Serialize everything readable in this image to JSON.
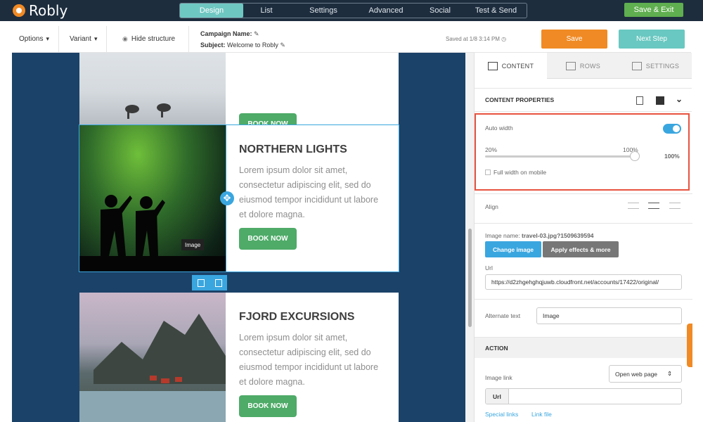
{
  "brand": {
    "name": "Robly"
  },
  "steps": [
    "Design",
    "List",
    "Settings",
    "Advanced",
    "Social",
    "Test & Send"
  ],
  "active_step": "Design",
  "topbar": {
    "save_exit": "Save & Exit"
  },
  "toolbar": {
    "options": "Options",
    "variant": "Variant",
    "hide_structure": "Hide structure",
    "campaign_label": "Campaign Name:",
    "subject_label": "Subject:",
    "subject_value": "Welcome to Robly",
    "saved_text": "Saved at 1/8 3:14 PM",
    "save": "Save",
    "next_step": "Next Step"
  },
  "cards": [
    {
      "book": "BOOK NOW"
    },
    {
      "title": "NORTHERN LIGHTS",
      "body": "Lorem ipsum dolor sit amet, consectetur adipiscing elit, sed do eiusmod tempor incididunt ut labore et dolore magna.",
      "book": "BOOK NOW",
      "tooltip": "Image"
    },
    {
      "title": "FJORD EXCURSIONS",
      "body": "Lorem ipsum dolor sit amet, consectetur adipiscing elit, sed do eiusmod tempor incididunt ut labore et dolore magna.",
      "book": "BOOK NOW"
    }
  ],
  "panel": {
    "tabs": [
      "CONTENT",
      "ROWS",
      "SETTINGS"
    ],
    "content_properties": "CONTENT PROPERTIES",
    "auto_width": "Auto width",
    "auto_width_on": true,
    "slider_min": "20%",
    "slider_max": "100%",
    "slider_value": "100%",
    "full_width_mobile": "Full width on mobile",
    "align": "Align",
    "image_name_label": "Image name:",
    "image_name": "travel-03.jpg?1509639594",
    "change_image": "Change image",
    "apply_effects": "Apply effects & more",
    "url_label": "Url",
    "url_value": "https://d2zhgehghqjuwb.cloudfront.net/accounts/17422/original/",
    "alt_label": "Alternate text",
    "alt_value": "Image",
    "action": "ACTION",
    "image_link": "Image link",
    "link_type": "Open web page",
    "url_prefix": "Url",
    "special_links": "Special links",
    "link_file": "Link file"
  },
  "colors": {
    "accent": "#3aa6df",
    "save": "#f08a24",
    "next": "#69c8c1",
    "canvas": "#1b4268",
    "book": "#4eab68",
    "highlight": "#e8533f"
  }
}
